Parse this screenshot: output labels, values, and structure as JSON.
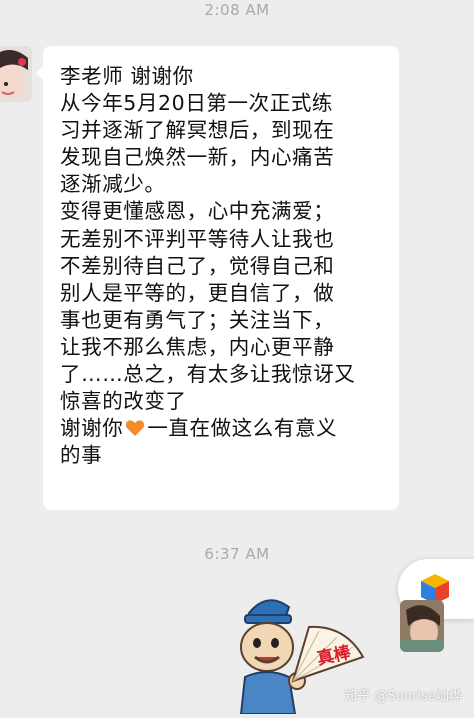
{
  "timestamps": [
    "2:08 AM",
    "6:37 AM"
  ],
  "message": {
    "lines": [
      "李老师 谢谢你",
      "从今年5月20日第一次正式练",
      "习并逐渐了解冥想后，到现在",
      "发现自己焕然一新，内心痛苦",
      "逐渐减少。",
      "变得更懂感恩，心中充满爱；",
      "无差别不评判平等待人让我也",
      "不差别待自己了，觉得自己和",
      "别人是平等的，更自信了，做",
      "事也更有勇气了；关注当下，",
      "让我不那么焦虑，内心更平静",
      "了……总之，有太多让我惊讶又",
      "惊喜的改变了"
    ],
    "thanks_before_emoji": "谢谢你",
    "emoji": "orange-heart",
    "thanks_after_emoji": "一直在做这么有意义",
    "last_line": "的事"
  },
  "sticker_text": "真棒",
  "watermark": "知乎 @Sunrise灿烨",
  "colors": {
    "background": "#ededed",
    "bubble": "#ffffff",
    "text": "#111111",
    "timestamp": "#a9a9a9",
    "heart": "#f58a2a",
    "sticker_red": "#d81e2c"
  }
}
